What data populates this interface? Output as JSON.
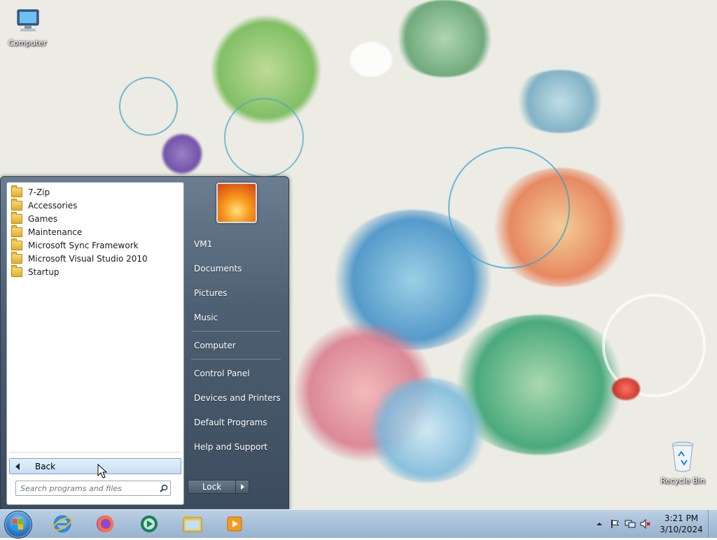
{
  "desktop": {
    "icons": [
      {
        "label": "Computer"
      },
      {
        "label": "Recycle Bin"
      }
    ]
  },
  "start_menu": {
    "programs": [
      {
        "label": "7-Zip"
      },
      {
        "label": "Accessories"
      },
      {
        "label": "Games"
      },
      {
        "label": "Maintenance"
      },
      {
        "label": "Microsoft Sync Framework"
      },
      {
        "label": "Microsoft Visual Studio 2010"
      },
      {
        "label": "Startup"
      }
    ],
    "back_label": "Back",
    "search_placeholder": "Search programs and files",
    "right_items": {
      "user": "VM1",
      "documents": "Documents",
      "pictures": "Pictures",
      "music": "Music",
      "computer": "Computer",
      "control_panel": "Control Panel",
      "devices_printers": "Devices and Printers",
      "default_programs": "Default Programs",
      "help_support": "Help and Support"
    },
    "lock_label": "Lock"
  },
  "taskbar": {
    "pinned": [
      "internet-explorer-icon",
      "firefox-icon",
      "media-center-icon",
      "file-explorer-icon",
      "media-player-icon"
    ],
    "clock": {
      "time": "3:21 PM",
      "date": "3/10/2024"
    }
  },
  "colors": {
    "taskbar": "#a8c0d8",
    "start_menu": "#4d5f72",
    "accent_blue": "#2d7ac8"
  }
}
